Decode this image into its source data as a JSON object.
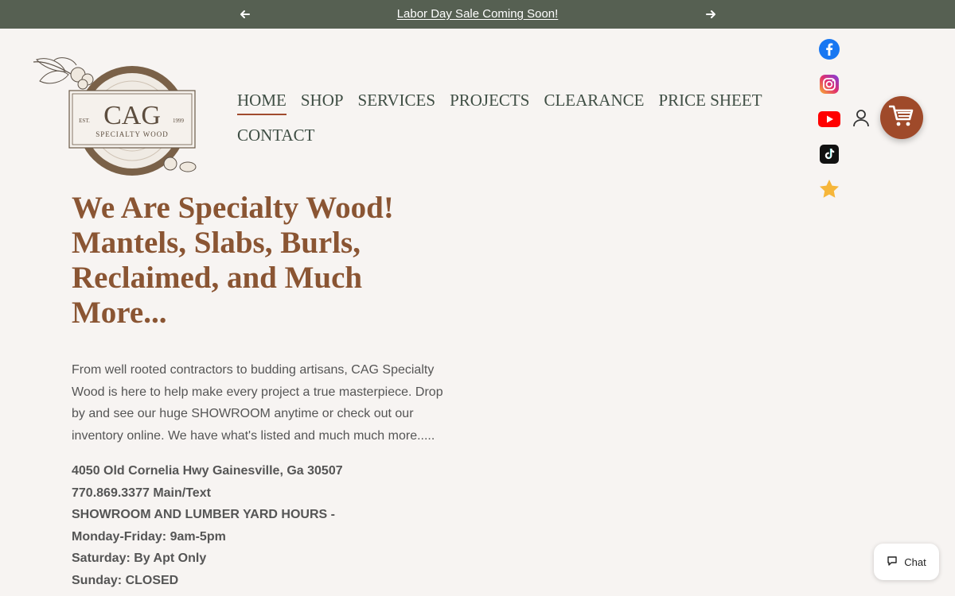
{
  "announcement": {
    "message": "Labor Day Sale Coming Soon!",
    "prev_icon": "arrow-left-icon",
    "next_icon": "arrow-right-icon"
  },
  "logo": {
    "name": "CAG",
    "tagline": "SPECIALTY WOOD",
    "est": "EST.",
    "year": "1999"
  },
  "nav": {
    "items": [
      {
        "label": "HOME",
        "active": true
      },
      {
        "label": "SHOP"
      },
      {
        "label": "SERVICES"
      },
      {
        "label": "PROJECTS"
      },
      {
        "label": "CLEARANCE"
      },
      {
        "label": "PRICE SHEET"
      },
      {
        "label": "CONTACT"
      }
    ]
  },
  "social": [
    "facebook-icon",
    "instagram-icon",
    "youtube-icon",
    "tiktok-icon",
    "star-icon"
  ],
  "header": {
    "account_icon": "account-icon",
    "cart_icon": "cart-icon"
  },
  "hero": {
    "title": "We Are Specialty Wood! Mantels, Slabs, Burls, Reclaimed, and Much More...",
    "body": "From well rooted contractors to budding artisans, CAG Specialty Wood is here to help make every project a true masterpiece. Drop by and see our huge SHOWROOM anytime or check out our inventory online. We have what's listed and much much more.....",
    "info": [
      "4050 Old Cornelia Hwy Gainesville, Ga 30507",
      "770.869.3377 Main/Text",
      "SHOWROOM AND LUMBER YARD HOURS -",
      "Monday-Friday: 9am-5pm",
      "Saturday: By Apt Only",
      "Sunday: CLOSED"
    ]
  },
  "chat": {
    "label": "Chat",
    "icon": "chat-bubble-icon"
  },
  "colors": {
    "announcement_bg": "#566052",
    "page_bg": "#f7f4f2",
    "heading": "#8a5533",
    "nav_text": "#3f4e44",
    "accent": "#9f4a2a"
  }
}
